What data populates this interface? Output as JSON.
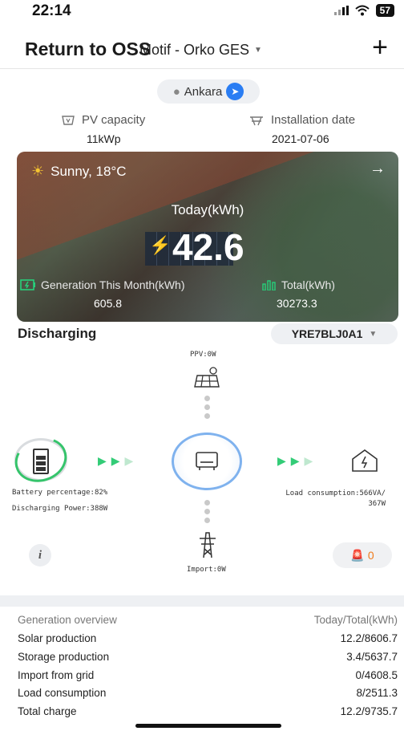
{
  "status_bar": {
    "time": "22:14",
    "battery": "57"
  },
  "nav": {
    "back_label": "Return to OSS",
    "plant_title": "Motif - Orko GES",
    "add_label": "+"
  },
  "location": {
    "city": "Ankara"
  },
  "plant_info": {
    "pv_capacity_label": "PV capacity",
    "pv_capacity_value": "11kWp",
    "install_date_label": "Installation date",
    "install_date_value": "2021-07-06"
  },
  "hero": {
    "weather": "Sunny, 18°C",
    "today_label": "Today(kWh)",
    "today_value": "42.6",
    "month_label": "Generation This Month(kWh)",
    "month_value": "605.8",
    "total_label": "Total(kWh)",
    "total_value": "30273.3"
  },
  "flow": {
    "mode": "Discharging",
    "device": "YRE7BLJ0A1",
    "ppv": "PPV:0W",
    "battery_percentage": "Battery percentage:82%",
    "battery_level": 0.82,
    "discharging_power": "Discharging Power:388W",
    "load_line1": "Load consumption:566VA/",
    "load_line2": "367W",
    "import": "Import:0W",
    "alarm_count": "0"
  },
  "overview": {
    "header_left": "Generation overview",
    "header_right": "Today/Total(kWh)",
    "rows": [
      {
        "label": "Solar production",
        "value": "12.2/8606.7"
      },
      {
        "label": "Storage production",
        "value": "3.4/5637.7"
      },
      {
        "label": "Import from grid",
        "value": "0/4608.5"
      },
      {
        "label": "Load consumption",
        "value": "8/2511.3"
      },
      {
        "label": "Total charge",
        "value": "12.2/9735.7"
      }
    ]
  },
  "colors": {
    "accent_blue": "#2a7df3",
    "flow_green": "#33cc77",
    "alarm_orange": "#f07a1a"
  }
}
